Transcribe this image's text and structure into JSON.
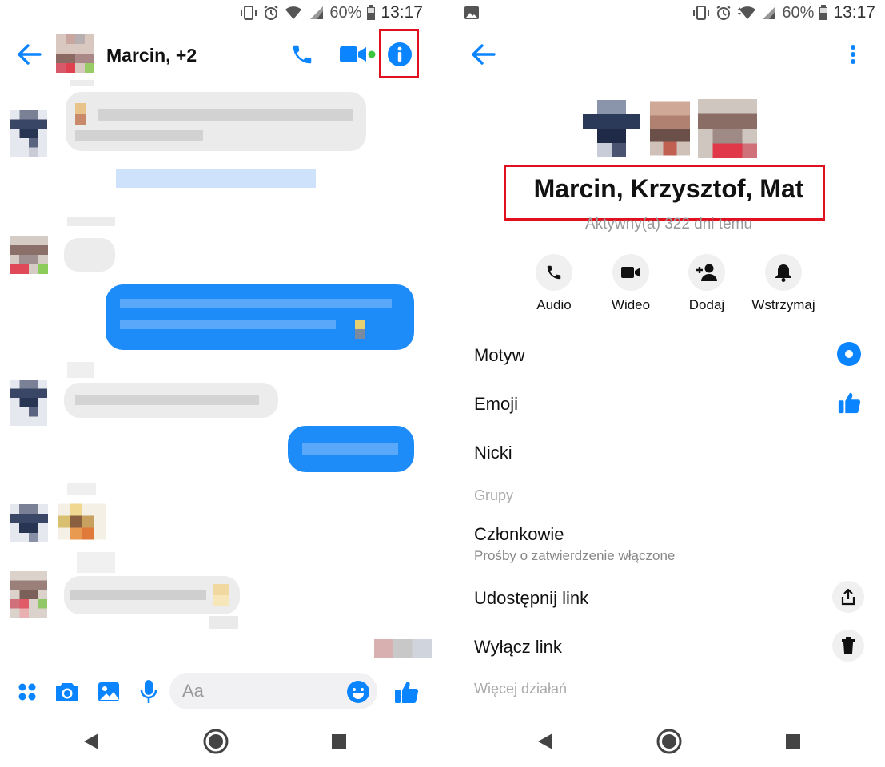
{
  "left_screen": {
    "status": {
      "battery": "60%",
      "time": "13:17"
    },
    "header": {
      "title": "Marcin, +2"
    },
    "composer": {
      "placeholder": "Aa"
    }
  },
  "right_screen": {
    "status": {
      "battery": "60%",
      "time": "13:17"
    },
    "group_name": "Marcin, Krzysztof, Mat",
    "active_status": "Aktywny(a) 322 dni temu",
    "actions": [
      {
        "label": "Audio",
        "icon": "phone-icon"
      },
      {
        "label": "Wideo",
        "icon": "video-camera-icon"
      },
      {
        "label": "Dodaj",
        "icon": "add-person-icon"
      },
      {
        "label": "Wstrzymaj",
        "icon": "bell-icon"
      }
    ],
    "settings": {
      "theme": "Motyw",
      "emoji": "Emoji",
      "nicknames": "Nicki",
      "groups_section": "Grupy",
      "members": "Członkowie",
      "members_sub": "Prośby o zatwierdzenie włączone",
      "share_link": "Udostępnij link",
      "disable_link": "Wyłącz link",
      "more_actions": "Więcej działań"
    },
    "colors": {
      "accent": "#0a84ff",
      "highlight": "#e0101f"
    }
  }
}
